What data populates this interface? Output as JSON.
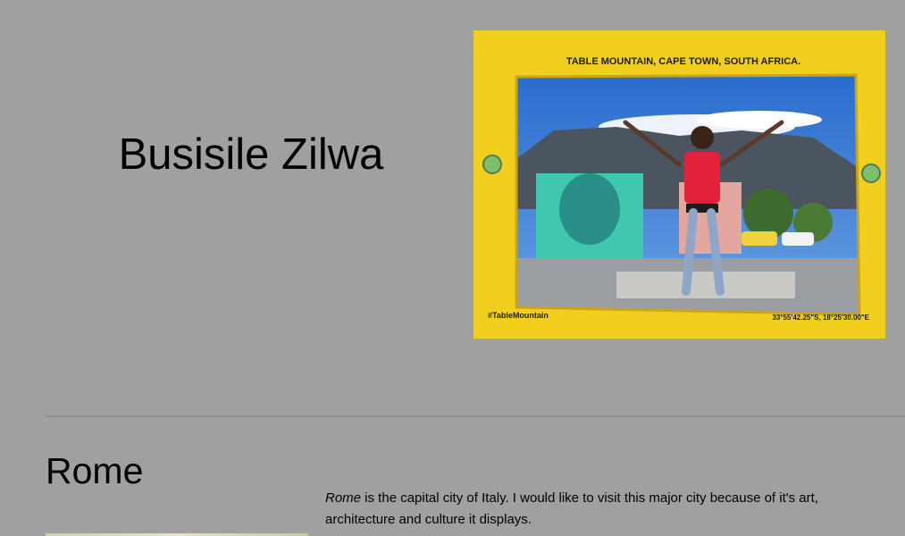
{
  "header": {
    "name": "Busisile Zilwa",
    "photo": {
      "frame_caption": "TABLE MOUNTAIN, CAPE TOWN, SOUTH AFRICA.",
      "hashtag": "#TableMountain",
      "coordinates": "33°55'42.25\"S, 18°25'30.00\"E",
      "frame_color": "#f2cf1f"
    }
  },
  "section": {
    "title": "Rome",
    "text_emphasis": "Rome",
    "text_rest": " is the capital city of Italy. I would like to visit this major city because of it's art, architecture and culture it displays."
  }
}
